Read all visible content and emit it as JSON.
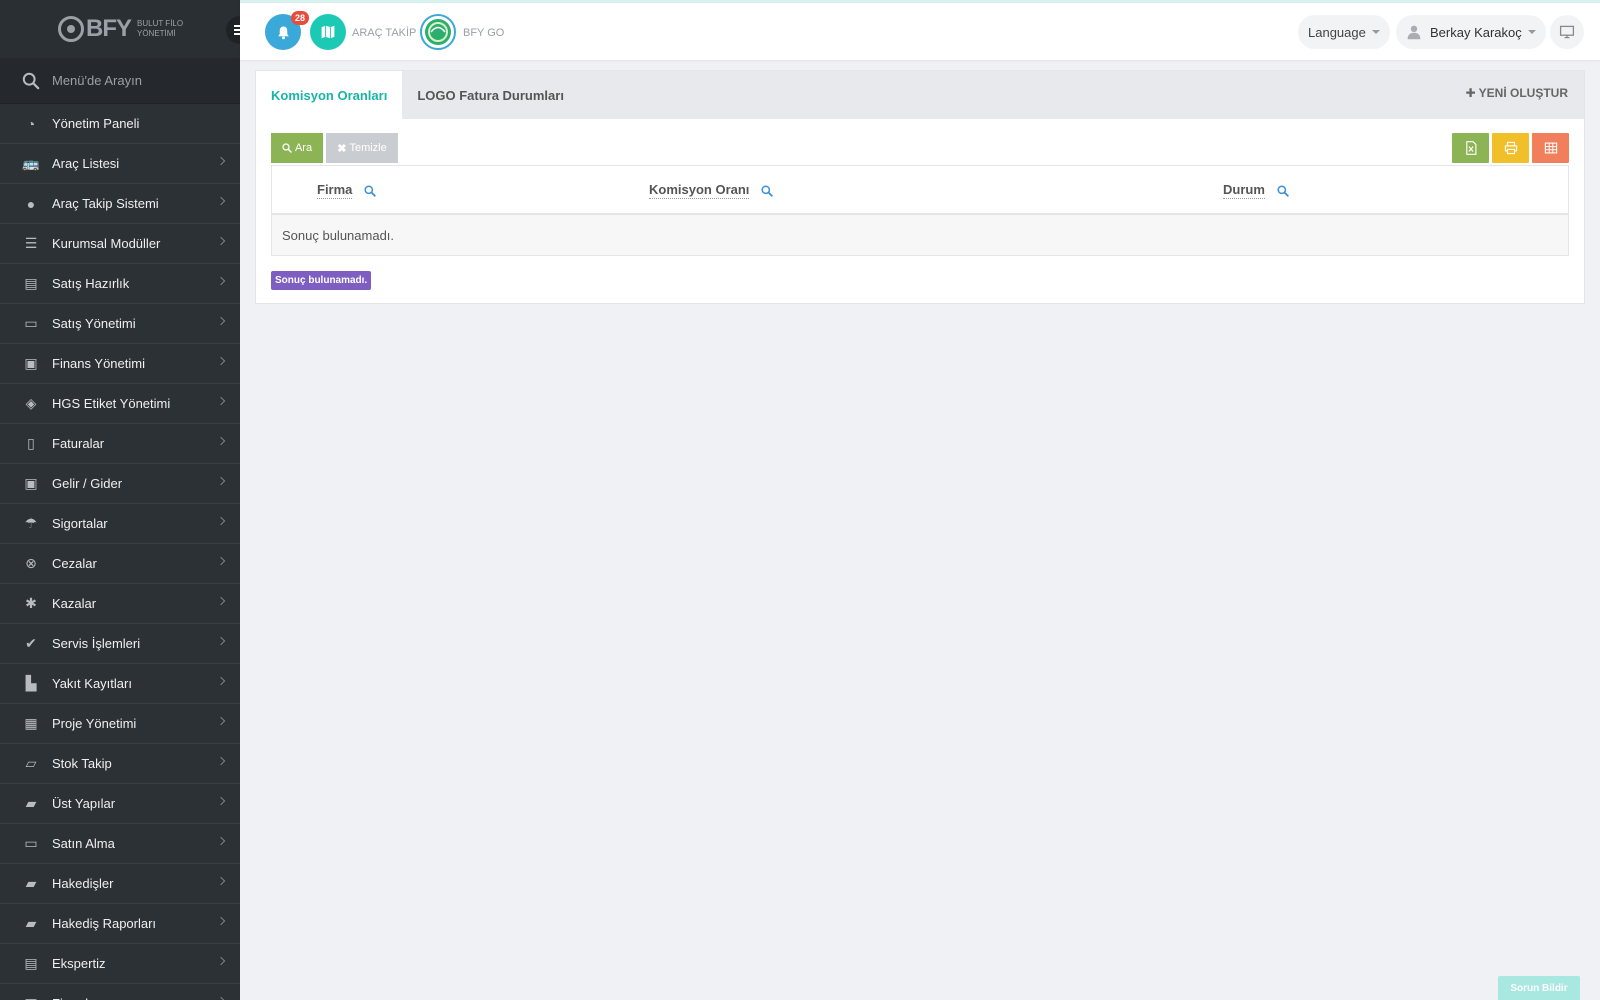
{
  "brand": {
    "name": "BFY",
    "subtitle_line1": "BULUT FİLO",
    "subtitle_line2": "YÖNETİMİ"
  },
  "sidebar": {
    "search_placeholder": "Menü'de Arayın",
    "items": [
      {
        "label": "Yönetim Paneli",
        "icon": "dashboard-icon",
        "has_children": false
      },
      {
        "label": "Araç Listesi",
        "icon": "bus-icon",
        "has_children": true
      },
      {
        "label": "Araç Takip Sistemi",
        "icon": "map-marker-icon",
        "has_children": true
      },
      {
        "label": "Kurumsal Modüller",
        "icon": "server-icon",
        "has_children": true
      },
      {
        "label": "Satış Hazırlık",
        "icon": "book-icon",
        "has_children": true
      },
      {
        "label": "Satış Yönetimi",
        "icon": "credit-card-icon",
        "has_children": true
      },
      {
        "label": "Finans Yönetimi",
        "icon": "money-icon",
        "has_children": true
      },
      {
        "label": "HGS Etiket Yönetimi",
        "icon": "ticket-icon",
        "has_children": true
      },
      {
        "label": "Faturalar",
        "icon": "file-icon",
        "has_children": true
      },
      {
        "label": "Gelir / Gider",
        "icon": "money-icon",
        "has_children": true
      },
      {
        "label": "Sigortalar",
        "icon": "umbrella-icon",
        "has_children": true
      },
      {
        "label": "Cezalar",
        "icon": "times-circle-icon",
        "has_children": true
      },
      {
        "label": "Kazalar",
        "icon": "car-crash-icon",
        "has_children": true
      },
      {
        "label": "Servis İşlemleri",
        "icon": "check-circle-icon",
        "has_children": true
      },
      {
        "label": "Yakıt Kayıtları",
        "icon": "fuel-pump-icon",
        "has_children": true
      },
      {
        "label": "Proje Yönetimi",
        "icon": "briefcase-icon",
        "has_children": true
      },
      {
        "label": "Stok Takip",
        "icon": "inbox-icon",
        "has_children": true
      },
      {
        "label": "Üst Yapılar",
        "icon": "truck-icon",
        "has_children": true
      },
      {
        "label": "Satın Alma",
        "icon": "credit-card-icon",
        "has_children": true
      },
      {
        "label": "Hakedişler",
        "icon": "truck-icon",
        "has_children": true
      },
      {
        "label": "Hakediş Raporları",
        "icon": "truck-icon",
        "has_children": true
      },
      {
        "label": "Ekspertiz",
        "icon": "list-alt-icon",
        "has_children": true
      },
      {
        "label": "Firmalar",
        "icon": "building-icon",
        "has_children": true
      }
    ]
  },
  "header": {
    "notification_count": "28",
    "arac_takip_label": "ARAÇ TAKİP",
    "bfy_go_label": "BFY GO",
    "language_label": "Language",
    "user_name": "Berkay Karakoç"
  },
  "tabs": [
    {
      "label": "Komisyon Oranları",
      "active": true
    },
    {
      "label": "LOGO Fatura Durumları",
      "active": false
    }
  ],
  "new_button_label": "YENİ OLUŞTUR",
  "toolbar": {
    "search_label": "Ara",
    "clear_label": "Temizle"
  },
  "grid": {
    "columns": [
      "Firma",
      "Komisyon Oranı",
      "Durum"
    ],
    "empty_message": "Sonuç bulunamadı."
  },
  "summary_tag": "Sonuç bulunamadı.",
  "report_button_label": "Sorun Bildir",
  "colors": {
    "sidebar_bg": "#2c3136",
    "accent": "#16b5a7",
    "search_button": "#8cb454",
    "print_button": "#f0bf2a",
    "columns_button": "#f27f5c",
    "summary_tag": "#7e5fc1",
    "notification_bell": "#3aa8d8",
    "map_button": "#1cc9b5"
  }
}
